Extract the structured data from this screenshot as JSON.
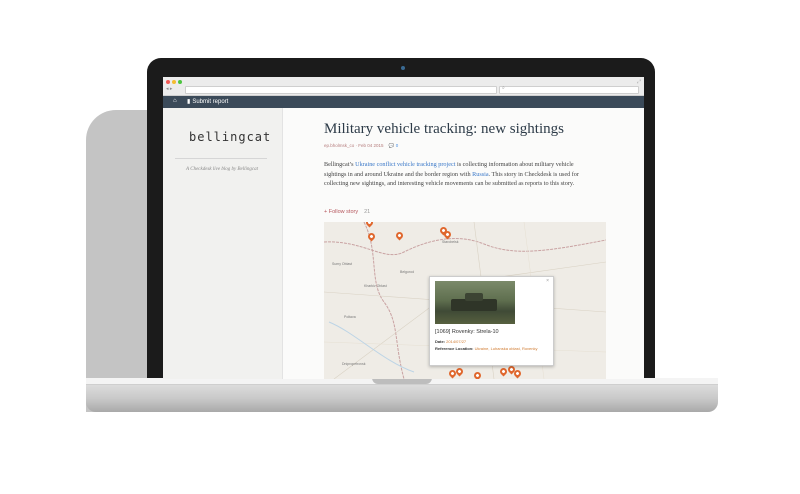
{
  "browser": {
    "nav": "◂ ▸"
  },
  "topbar": {
    "submit_label": "Submit report"
  },
  "sidebar": {
    "logo": "bellingcat",
    "description": "A Checkdesk live blog by Bellingcat"
  },
  "post": {
    "title": "Military vehicle tracking: new sightings",
    "author": "ep.bholmsk_co",
    "date": "Feb 04 2015",
    "comment_count": "0",
    "desc_prefix": "Bellingcat’s ",
    "desc_link": "Ukraine conflict vehicle tracking project",
    "desc_mid": " is collecting information about military vehicle sightings in and around Ukraine and the border region with ",
    "desc_russia": "Russia",
    "desc_suffix": ". This story in Checkdesk is used for collecting new sightings, and interesting vehicle movements can be submitted as reports to this story.",
    "follow_label": "+ Follow story",
    "follow_count": "21"
  },
  "map": {
    "places": [
      "Sumy Oblast",
      "Belgorod",
      "Kharkiv Oblast",
      "Poltava",
      "Dnipropetrovsk",
      "Starobelsk"
    ],
    "popup": {
      "title": "[1069] Rovenky: Strela-10",
      "date_label": "Date:",
      "date_value": "2014/07/27",
      "loc_label": "Reference Location:",
      "loc_value": "Ukraine, Luhanska oblast, Rovenky"
    },
    "pin_color": "#e0672d"
  },
  "colors": {
    "topbar": "#3b4a59",
    "title": "#2d3b48",
    "link": "#3a78c8",
    "accent": "#b5565c"
  }
}
